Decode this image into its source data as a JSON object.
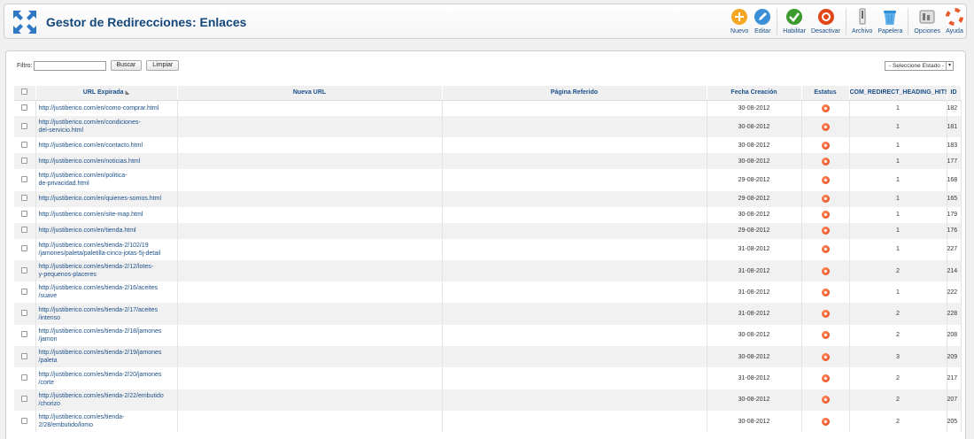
{
  "header": {
    "title": "Gestor de Redirecciones: Enlaces"
  },
  "toolbar": [
    {
      "label": "Nuevo",
      "icon": "plus-icon"
    },
    {
      "label": "Editar",
      "icon": "edit-icon"
    },
    {
      "label": "Habilitar",
      "icon": "check-icon"
    },
    {
      "label": "Desactivar",
      "icon": "disable-icon"
    },
    {
      "label": "Archivo",
      "icon": "archive-icon"
    },
    {
      "label": "Papelera",
      "icon": "trash-icon"
    },
    {
      "label": "Opciones",
      "icon": "options-icon"
    },
    {
      "label": "Ayuda",
      "icon": "help-icon"
    }
  ],
  "filter": {
    "label": "Filtro:",
    "value": "",
    "search_label": "Buscar",
    "clear_label": "Limpiar"
  },
  "state_select": {
    "selected": "- Seleccione Estado -"
  },
  "columns": {
    "expired_url": "URL Expirada",
    "new_url": "Nueva URL",
    "referrer": "Página Referido",
    "date": "Fecha Creación",
    "status": "Estatus",
    "hits": "COM_REDIRECT_HEADING_HITS",
    "id": "ID"
  },
  "rows": [
    {
      "url": [
        "http://justiberico.com/en/como-comprar.html"
      ],
      "new_url": "",
      "referrer": "",
      "date": "30-08-2012",
      "hits": "1",
      "id": "182"
    },
    {
      "url": [
        "http://justiberico.com/en/condiciones-",
        "del-servicio.html"
      ],
      "new_url": "",
      "referrer": "",
      "date": "30-08-2012",
      "hits": "1",
      "id": "181"
    },
    {
      "url": [
        "http://justiberico.com/en/contacto.html"
      ],
      "new_url": "",
      "referrer": "",
      "date": "30-08-2012",
      "hits": "1",
      "id": "183"
    },
    {
      "url": [
        "http://justiberico.com/en/noticias.html"
      ],
      "new_url": "",
      "referrer": "",
      "date": "30-08-2012",
      "hits": "1",
      "id": "177"
    },
    {
      "url": [
        "http://justiberico.com/en/politica-",
        "de-privacidad.html"
      ],
      "new_url": "",
      "referrer": "",
      "date": "29-08-2012",
      "hits": "1",
      "id": "168"
    },
    {
      "url": [
        "http://justiberico.com/en/quienes-somos.html"
      ],
      "new_url": "",
      "referrer": "",
      "date": "29-08-2012",
      "hits": "1",
      "id": "165"
    },
    {
      "url": [
        "http://justiberico.com/en/site-map.html"
      ],
      "new_url": "",
      "referrer": "",
      "date": "30-08-2012",
      "hits": "1",
      "id": "179"
    },
    {
      "url": [
        "http://justiberico.com/en/tienda.html"
      ],
      "new_url": "",
      "referrer": "",
      "date": "29-08-2012",
      "hits": "1",
      "id": "176"
    },
    {
      "url": [
        "http://justiberico.com/es/tienda-2/102/19",
        "/jamones/paleta/paletilla-cinco-jotas-5j-detail"
      ],
      "new_url": "",
      "referrer": "",
      "date": "31-08-2012",
      "hits": "1",
      "id": "227"
    },
    {
      "url": [
        "http://justiberico.com/es/tienda-2/12/lotes-",
        "y-pequenos-placeres"
      ],
      "new_url": "",
      "referrer": "",
      "date": "31-08-2012",
      "hits": "2",
      "id": "214"
    },
    {
      "url": [
        "http://justiberico.com/es/tienda-2/16/aceites",
        "/suave"
      ],
      "new_url": "",
      "referrer": "",
      "date": "31-08-2012",
      "hits": "1",
      "id": "222"
    },
    {
      "url": [
        "http://justiberico.com/es/tienda-2/17/aceites",
        "/intenso"
      ],
      "new_url": "",
      "referrer": "",
      "date": "31-08-2012",
      "hits": "2",
      "id": "228"
    },
    {
      "url": [
        "http://justiberico.com/es/tienda-2/18/jamones",
        "/jamon"
      ],
      "new_url": "",
      "referrer": "",
      "date": "30-08-2012",
      "hits": "2",
      "id": "208"
    },
    {
      "url": [
        "http://justiberico.com/es/tienda-2/19/jamones",
        "/paleta"
      ],
      "new_url": "",
      "referrer": "",
      "date": "30-08-2012",
      "hits": "3",
      "id": "209"
    },
    {
      "url": [
        "http://justiberico.com/es/tienda-2/20/jamones",
        "/corte"
      ],
      "new_url": "",
      "referrer": "",
      "date": "31-08-2012",
      "hits": "2",
      "id": "217"
    },
    {
      "url": [
        "http://justiberico.com/es/tienda-2/22/embutido",
        "/chorizo"
      ],
      "new_url": "",
      "referrer": "",
      "date": "30-08-2012",
      "hits": "2",
      "id": "207"
    },
    {
      "url": [
        "http://justiberico.com/es/tienda-",
        "2/28/embutido/lomo"
      ],
      "new_url": "",
      "referrer": "",
      "date": "30-08-2012",
      "hits": "2",
      "id": "205"
    }
  ],
  "colors": {
    "title": "#13467b",
    "link": "#1a4f8a",
    "status_disabled": "#e2471a"
  }
}
